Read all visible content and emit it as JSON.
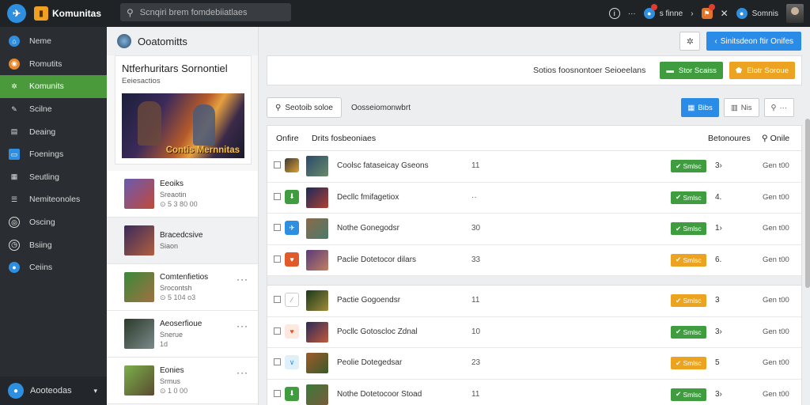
{
  "topbar": {
    "brand": "Komunitas",
    "search_placeholder": "Scnqiri brem fomdebiiatlaes",
    "right_items": [
      {
        "icon": "info-icon",
        "label": ""
      },
      {
        "icon": "more-icon",
        "label": "···"
      },
      {
        "icon": "chat-icon",
        "label": "s finne"
      },
      {
        "icon": "chevron-right-icon",
        "label": "›"
      },
      {
        "icon": "bell-icon",
        "label": ""
      },
      {
        "icon": "crossed-tools-icon",
        "label": ""
      },
      {
        "icon": "profile-icon",
        "label": "Somnis"
      }
    ]
  },
  "sidebar": {
    "items": [
      {
        "label": "Neme",
        "icon": "home-icon",
        "color": "#2e8fe0"
      },
      {
        "label": "Romutits",
        "icon": "community-icon",
        "color": "#e8872a"
      },
      {
        "label": "Komunits",
        "icon": "network-icon",
        "color": "#4a9a3c",
        "active": true
      },
      {
        "label": "Scilne",
        "icon": "pen-icon",
        "color": "#2e8fe0"
      },
      {
        "label": "Deaing",
        "icon": "page-icon",
        "color": "#2e8fe0"
      },
      {
        "label": "Foenings",
        "icon": "monitor-icon",
        "color": "#2e8fe0"
      },
      {
        "label": "Seutling",
        "icon": "grid-icon",
        "color": "#2e8fe0"
      },
      {
        "label": "Nemiteonoles",
        "icon": "list-icon",
        "color": "#2e8fe0"
      },
      {
        "label": "Oscing",
        "icon": "target-icon",
        "color": "#2e8fe0"
      },
      {
        "label": "Bsiing",
        "icon": "clock-icon",
        "color": "#2e8fe0"
      },
      {
        "label": "Ceiins",
        "icon": "coin-icon",
        "color": "#2e8fe0"
      }
    ],
    "footer_label": "Aooteodas"
  },
  "panel": {
    "title": "Ooatomitts",
    "feature": {
      "title": "Ntferhuritars Sornontiel",
      "subtitle": "Eeiesactios",
      "banner_caption": "Contis Mernnitas"
    },
    "items": [
      {
        "title": "Eeoiks",
        "sub": "Sreaotin",
        "meta": "5 3 80 00",
        "thumb": "linear-gradient(135deg,#6a5ab0,#c04a3a)"
      },
      {
        "title": "Bracedcsive",
        "sub": "Siaon",
        "meta": "",
        "thumb": "linear-gradient(135deg,#3a2a5a,#b06040)",
        "selected": true
      },
      {
        "title": "Comtenfietios",
        "sub": "Srocontsh",
        "meta": "5 104 o3",
        "thumb": "linear-gradient(135deg,#3a8a3a,#a07040)"
      },
      {
        "title": "Aeoserfioue",
        "sub": "Snerue",
        "meta": "1d",
        "thumb": "linear-gradient(135deg,#2a3a2a,#7a8a8a)"
      },
      {
        "title": "Eonies",
        "sub": "Srmus",
        "meta": "1 0 00",
        "thumb": "linear-gradient(135deg,#7ab04a,#5a4a30)"
      }
    ]
  },
  "main": {
    "top_button": "Sinitsdeon ftir Onifes",
    "hint": "Sotios foosnontoer Seioeelans",
    "green_btn": "Stor Scaiss",
    "orange_btn": "Elotr Soroue",
    "filter_btn": "Seotoib soloe",
    "filter_label": "Oosseiomonwbrt",
    "view_btn": "Bibs",
    "list_btn": "Nis",
    "search_btn": "···",
    "table": {
      "headers": [
        "Onfire",
        "Drits fosbeoniaes",
        "Betonoures",
        "Onile"
      ],
      "rows": [
        {
          "name": "Coolsc fataseicay Gseons",
          "num": "11",
          "status": "Smlsc",
          "status_color": "#3f9d40",
          "count": "3›",
          "time": "Gen t00",
          "sicon_color": "#e0a030",
          "thumb": "linear-gradient(135deg,#2a4a6a,#6a8a6a)"
        },
        {
          "name": "Decllc fmifagetiox",
          "num": "··",
          "status": "Smlsc",
          "status_color": "#3f9d40",
          "count": "4.",
          "time": "Gen t00",
          "sicon_color": "#3f9d40",
          "thumb": "linear-gradient(135deg,#1a2a5a,#b04030)"
        },
        {
          "name": "Nothe Gonegodsr",
          "num": "30",
          "status": "Smlsc",
          "status_color": "#3f9d40",
          "count": "1›",
          "time": "Gen t00",
          "sicon_color": "#2e8fe0",
          "thumb": "linear-gradient(135deg,#8a6a4a,#4a7a6a)"
        },
        {
          "name": "Paclie Dotetocor dilars",
          "num": "33",
          "status": "Smlsc",
          "status_color": "#eba321",
          "count": "6.",
          "time": "Gen t00",
          "sicon_color": "#e05a2a",
          "thumb": "linear-gradient(135deg,#5a3a7a,#c08060)"
        },
        {
          "name": "Pactie Gogoendsr",
          "num": "11",
          "status": "Smlsc",
          "status_color": "#eba321",
          "count": "3",
          "time": "Gen t00",
          "sicon_color": "#dddddd",
          "thumb": "linear-gradient(135deg,#1a3a1a,#a08a3a)"
        },
        {
          "name": "Pocllc Gotoscloc Zdnal",
          "num": "10",
          "status": "Smlsc",
          "status_color": "#3f9d40",
          "count": "3›",
          "time": "Gen t00",
          "sicon_color": "#f0c0b0",
          "thumb": "linear-gradient(135deg,#2a2a5a,#c05a3a)"
        },
        {
          "name": "Peolie Dotegedsar",
          "num": "23",
          "status": "Smlsc",
          "status_color": "#eba321",
          "count": "5",
          "time": "Gen t00",
          "sicon_color": "#c0e0f0",
          "thumb": "linear-gradient(135deg,#a05a2a,#3a5a2a)"
        },
        {
          "name": "Nothe Dotetocoor Stoad",
          "num": "11",
          "status": "Smlsc",
          "status_color": "#3f9d40",
          "count": "3›",
          "time": "Gen t00",
          "sicon_color": "#3f9d40",
          "thumb": "linear-gradient(135deg,#3a7a3a,#7a5a3a)"
        }
      ]
    }
  }
}
